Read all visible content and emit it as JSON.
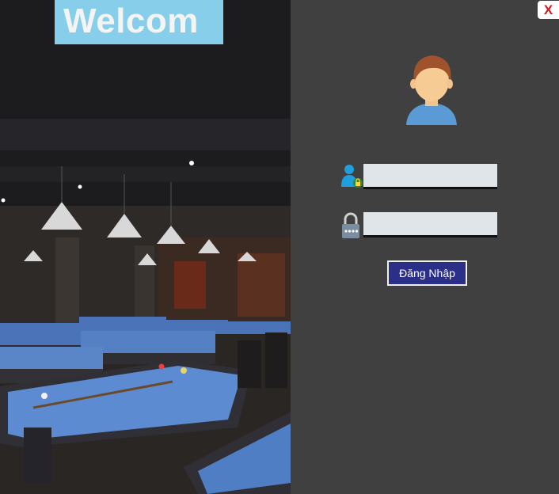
{
  "banner": {
    "welcome_text": "Welcom"
  },
  "window": {
    "close_label": "X"
  },
  "login": {
    "username_value": "",
    "password_value": "",
    "submit_label": "Đăng Nhập"
  },
  "icons": {
    "avatar": "user-avatar-icon",
    "username": "user-lock-icon",
    "password": "padlock-icon",
    "close": "close-icon"
  },
  "colors": {
    "banner_bg": "#87ceeb",
    "panel_bg": "#404040",
    "button_bg": "#2b2f88",
    "close_text": "#e0141e",
    "field_bg": "#e0e5e9"
  }
}
